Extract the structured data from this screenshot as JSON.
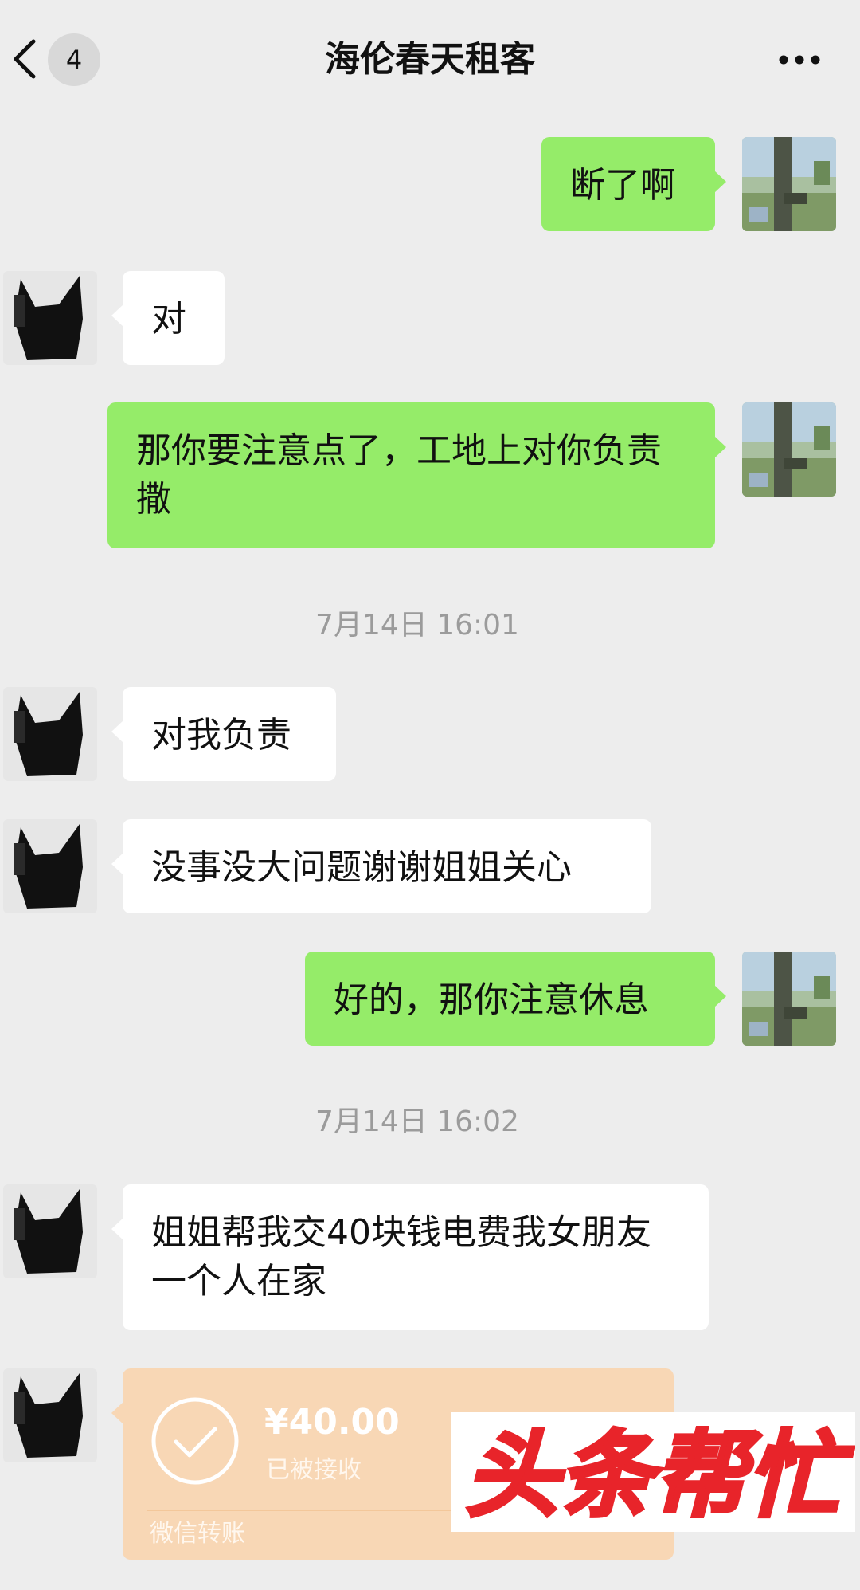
{
  "header": {
    "unread_count": "4",
    "title": "海伦春天租客"
  },
  "messages": {
    "m1": "断了啊",
    "m2": "对",
    "m3": "那你要注意点了，工地上对你负责撒",
    "ts1": "7月14日 16:01",
    "m4": "对我负责",
    "m5": "没事没大问题谢谢姐姐关心",
    "m6": "好的，那你注意休息",
    "ts2": "7月14日 16:02",
    "m7": "姐姐帮我交40块钱电费我女朋友一个人在家"
  },
  "transfer": {
    "amount": "¥40.00",
    "status": "已被接收",
    "footer": "微信转账"
  },
  "watermark": {
    "text": "头条帮忙"
  },
  "colors": {
    "background": "#ededed",
    "outgoing_bubble": "#95ec69",
    "incoming_bubble": "#ffffff",
    "transfer_card": "#f8d7b5",
    "watermark_red": "#e8242a"
  }
}
